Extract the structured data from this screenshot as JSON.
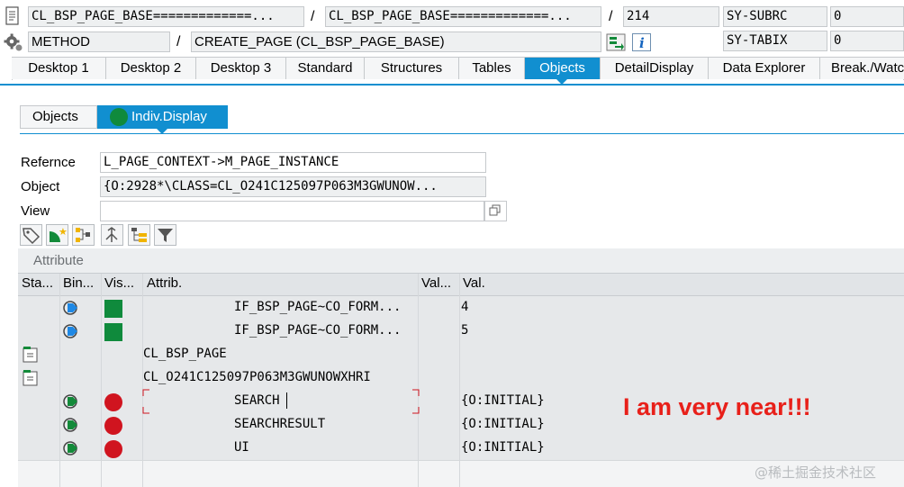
{
  "toolbar": {
    "program1": "CL_BSP_PAGE_BASE=============...",
    "sep1": "/",
    "program2": "CL_BSP_PAGE_BASE=============...",
    "sep2": "/",
    "line": "214",
    "var1_name": "SY-SUBRC",
    "var1_value": "0",
    "method_type": "METHOD",
    "sep3": "/",
    "method_name": "CREATE_PAGE (CL_BSP_PAGE_BASE)",
    "var2_name": "SY-TABIX",
    "var2_value": "0"
  },
  "tabs": [
    {
      "label": "Desktop 1"
    },
    {
      "label": "Desktop 2"
    },
    {
      "label": "Desktop 3"
    },
    {
      "label": "Standard"
    },
    {
      "label": "Structures"
    },
    {
      "label": "Tables"
    },
    {
      "label": "Objects"
    },
    {
      "label": "DetailDisplay"
    },
    {
      "label": "Data Explorer"
    },
    {
      "label": "Break./Watc"
    }
  ],
  "subtabs": {
    "objects": "Objects",
    "indiv": "Indiv.Display"
  },
  "form": {
    "reference_label": "Refernce",
    "reference_value": "L_PAGE_CONTEXT->M_PAGE_INSTANCE",
    "object_label": "Object",
    "object_value": "{O:2928*\\CLASS=CL_O241C125097P063M3GWUNOW...",
    "view_label": "View",
    "view_value": ""
  },
  "table": {
    "title": "Attribute",
    "headers": [
      "Sta...",
      "Bin...",
      "Vis...",
      "Attrib.",
      "Val...",
      "Val."
    ],
    "rows": [
      {
        "attrib": "IF_BSP_PAGE~CO_FORM...",
        "val": "4"
      },
      {
        "attrib": "IF_BSP_PAGE~CO_FORM...",
        "val": "5"
      },
      {
        "attrib": "CL_BSP_PAGE",
        "val": ""
      },
      {
        "attrib": "CL_O241C125097P063M3GWUNOWXHRI",
        "val": ""
      },
      {
        "attrib": "SEARCH",
        "val": "{O:INITIAL}"
      },
      {
        "attrib": "SEARCHRESULT",
        "val": "{O:INITIAL}"
      },
      {
        "attrib": "UI",
        "val": "{O:INITIAL}"
      }
    ]
  },
  "annotation": "I am very near!!!",
  "watermark": "@稀土掘金技术社区",
  "colors": {
    "accent": "#118fd0",
    "green": "#0f8a3c",
    "red": "#d0141f",
    "annotation": "#e8201a"
  }
}
